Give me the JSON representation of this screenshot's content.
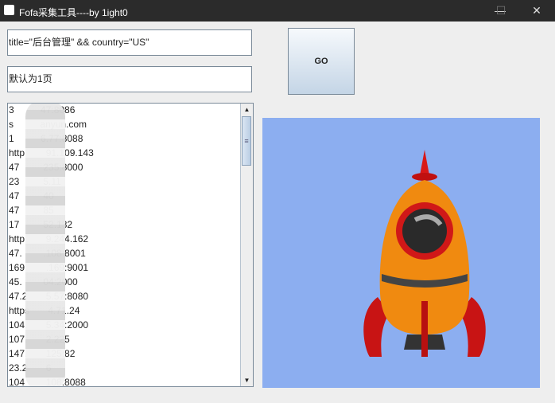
{
  "window": {
    "title": "Fofa采集工具----by 1ight0",
    "minimize": "—",
    "maximize": "☐",
    "close": "✕"
  },
  "query_input": {
    "value": "title=\"后台管理\" && country=\"US\""
  },
  "page_input": {
    "value": "默认为1页"
  },
  "go_button": {
    "label": "GO"
  },
  "results": [
    "3          47:8086",
    "s          anyun.com",
    "1          6.77:8088",
    "http        91.109.143",
    "47         235:8000",
    "23         5.11",
    "47         40",
    "47         85",
    "17         52.132",
    "http        9.244.162",
    "47.        .108:8001",
    "169        .169:9001",
    "45.        04:2000",
    "47.2       5.57:8080",
    "https       4.71.24",
    "104.       5.34:2000",
    "107.       2.225",
    "147.       125:82",
    "23.2       6",
    "104        108:8088"
  ],
  "scrollbar": {
    "up": "▲",
    "down": "▼",
    "grip": "≡"
  },
  "image": {
    "subject": "rocket-illustration",
    "background": "#8caef0"
  }
}
